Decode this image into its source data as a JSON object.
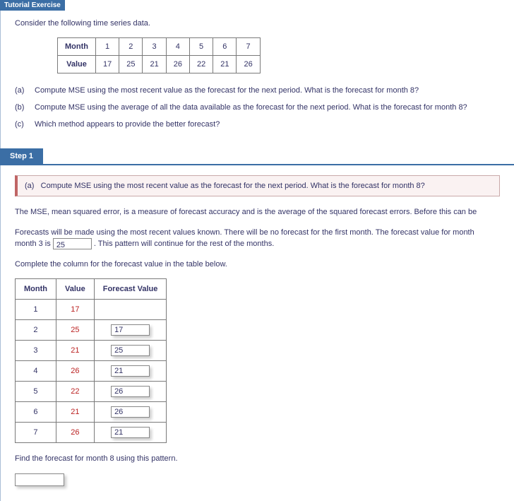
{
  "tutorial_label": "Tutorial Exercise",
  "intro": "Consider the following time series data.",
  "data_table": {
    "row_labels": [
      "Month",
      "Value"
    ],
    "months": [
      "1",
      "2",
      "3",
      "4",
      "5",
      "6",
      "7"
    ],
    "values": [
      "17",
      "25",
      "21",
      "26",
      "22",
      "21",
      "26"
    ]
  },
  "questions": {
    "a": {
      "label": "(a)",
      "text": "Compute MSE using the most recent value as the forecast for the next period. What is the forecast for month 8?"
    },
    "b": {
      "label": "(b)",
      "text": "Compute MSE using the average of all the data available as the forecast for the next period. What is the forecast for month 8?"
    },
    "c": {
      "label": "(c)",
      "text": "Which method appears to provide the better forecast?"
    }
  },
  "step": {
    "tab": "Step 1",
    "sub_q_label": "(a)",
    "sub_q_text": "Compute MSE using the most recent value as the forecast for the next period. What is the forecast for month 8?",
    "p1": "The MSE, mean squared error, is a measure of forecast accuracy and is the average of the squared forecast errors. Before this can be",
    "p2a": "Forecasts will be made using the most recent values known. There will be no forecast for the first month. The forecast value for month",
    "p2b": "month 3 is",
    "p2_input": "25",
    "p2c": ". This pattern will continue for the rest of the months.",
    "p3": "Complete the column for the forecast value in the table below.",
    "forecast_table": {
      "headers": [
        "Month",
        "Value",
        "Forecast Value"
      ],
      "rows": [
        {
          "month": "1",
          "value": "17",
          "forecast": ""
        },
        {
          "month": "2",
          "value": "25",
          "forecast": "17"
        },
        {
          "month": "3",
          "value": "21",
          "forecast": "25"
        },
        {
          "month": "4",
          "value": "26",
          "forecast": "21"
        },
        {
          "month": "5",
          "value": "22",
          "forecast": "26"
        },
        {
          "month": "6",
          "value": "21",
          "forecast": "26"
        },
        {
          "month": "7",
          "value": "26",
          "forecast": "21"
        }
      ]
    },
    "p4": "Find the forecast for month 8 using this pattern."
  }
}
